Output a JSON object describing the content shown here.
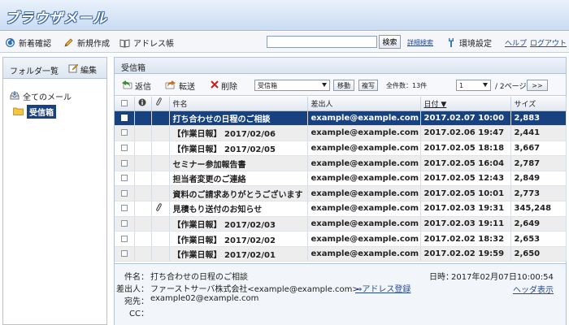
{
  "app": {
    "title": "ブラウザメール"
  },
  "toolbar": {
    "check_new": "新着確認",
    "compose": "新規作成",
    "address_book": "アドレス帳",
    "search_value": "",
    "search_button": "検索",
    "advanced_search": "詳細検索",
    "settings": "環境設定",
    "help": "ヘルプ",
    "logout": "ログアウト"
  },
  "sidebar": {
    "title": "フォルダ一覧",
    "edit": "編集",
    "all_mail": "全てのメール",
    "inbox": "受信箱"
  },
  "main": {
    "title": "受信箱",
    "reply": "返信",
    "forward": "転送",
    "delete": "削除",
    "folder_select": "受信箱",
    "move_button": "移動",
    "copy_button": "複写",
    "total": "全件数：13件",
    "page_select": "1",
    "pages": "/ 2ページ",
    "next": ">>"
  },
  "table": {
    "columns": {
      "subject": "件名",
      "from": "差出人",
      "date": "日付 ▼",
      "size": "サイズ"
    },
    "rows": [
      {
        "subject": "打ち合わせの日程のご相談",
        "from": "example@example.com",
        "date": "2017.02.07 10:00",
        "size": "2,883",
        "attach": false
      },
      {
        "subject": "【作業日報】 2017/02/06",
        "from": "example@example.com",
        "date": "2017.02.06 19:47",
        "size": "2,441",
        "attach": false
      },
      {
        "subject": "【作業日報】 2017/02/05",
        "from": "example@example.com",
        "date": "2017.02.05 18:18",
        "size": "3,667",
        "attach": false
      },
      {
        "subject": "セミナー参加報告書",
        "from": "example@example.com",
        "date": "2017.02.05 16:04",
        "size": "2,787",
        "attach": false
      },
      {
        "subject": "担当者変更のご連絡",
        "from": "example@example.com",
        "date": "2017.02.05 12:43",
        "size": "2,849",
        "attach": false
      },
      {
        "subject": "資料のご請求ありがとうございます",
        "from": "example@example.com",
        "date": "2017.02.05 10:01",
        "size": "2,773",
        "attach": false
      },
      {
        "subject": "見積もり送付のお知らせ",
        "from": "example@example.com",
        "date": "2017.02.03 19:31",
        "size": "345,248",
        "attach": true
      },
      {
        "subject": "【作業日報】 2017/02/03",
        "from": "example@example.com",
        "date": "2017.02.03 19:11",
        "size": "2,649",
        "attach": false
      },
      {
        "subject": "【作業日報】 2017/02/02",
        "from": "example@example.com",
        "date": "2017.02.02 18:32",
        "size": "2,653",
        "attach": false
      },
      {
        "subject": "【作業日報】 2017/02/01",
        "from": "example@example.com",
        "date": "2017.02.02 19:59",
        "size": "2,650",
        "attach": false
      }
    ]
  },
  "preview": {
    "subject_label": "件名：",
    "subject": "打ち合わせの日程のご相談",
    "date_label": "日時：",
    "date": "2017年02月07日10:00:54",
    "from_label": "差出人：",
    "from": "ファーストサーバ株式会社<example@example.com>",
    "add_address": "⇒アドレス登録",
    "header_view": "ヘッダ表示",
    "to_label": "宛先：",
    "to": "example02@example.com",
    "cc_label": "CC："
  },
  "colors": {
    "selected_row": "#17417f",
    "header_bg": "#c9dcf3"
  }
}
